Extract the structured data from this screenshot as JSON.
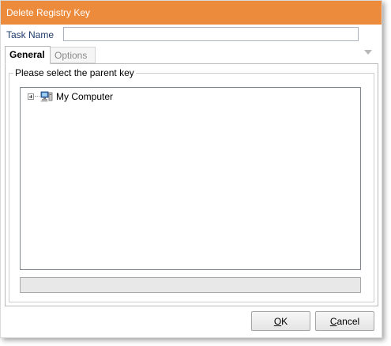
{
  "window": {
    "title": "Delete Registry Key",
    "accent_color": "#ec8b3c"
  },
  "form": {
    "task_name_label": "Task Name",
    "task_name_value": ""
  },
  "tabs": [
    {
      "label": "General",
      "active": true
    },
    {
      "label": "Options",
      "active": false
    }
  ],
  "general": {
    "group_caption": "Please select the parent key",
    "tree": [
      {
        "label": "My Computer",
        "icon": "computer-icon",
        "expandable": true
      }
    ],
    "status_text": ""
  },
  "buttons": {
    "ok": {
      "mnemonic": "O",
      "rest": "K"
    },
    "cancel": {
      "mnemonic": "C",
      "rest": "ancel"
    }
  }
}
